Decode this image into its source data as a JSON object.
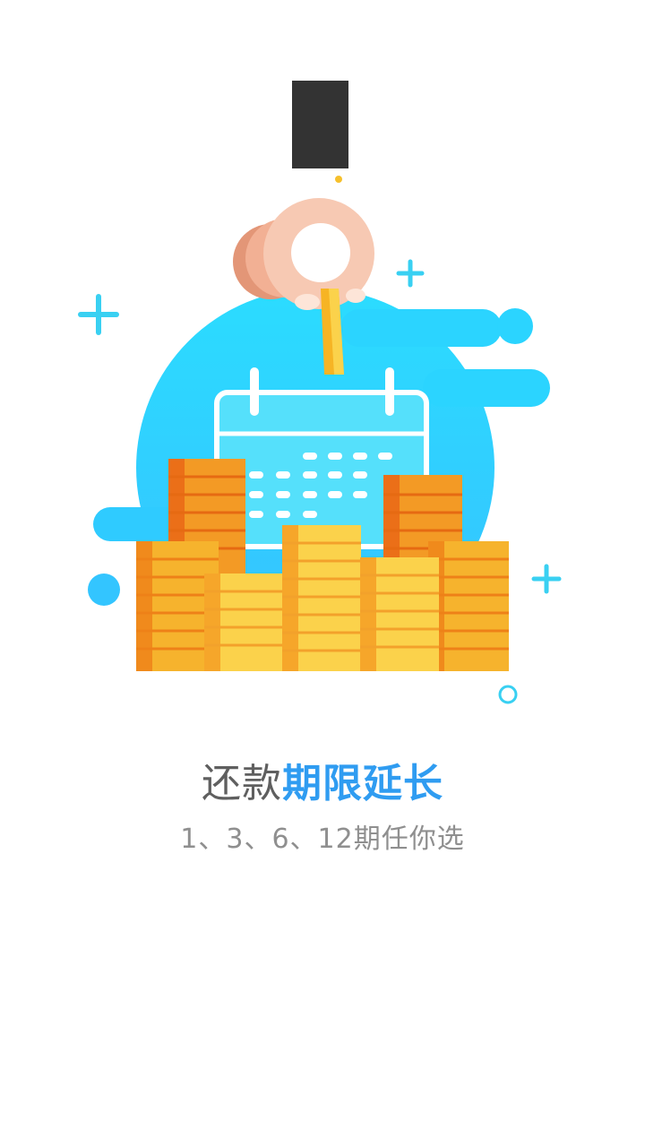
{
  "headline": {
    "normal": "还款",
    "highlight": "期限延长"
  },
  "subtitle": "1、3、6、12期任你选",
  "colors": {
    "accent": "#2f9cf1",
    "title_gray": "#5f5f5f",
    "subtitle_gray": "#8f8f8f",
    "blob_blue": "#2ad0ff",
    "coin_orange": "#f39a25",
    "coin_yellow": "#fbd24b"
  },
  "illustration": {
    "description_icon": "hand-inserting-coin-into-calendar-with-coin-stacks"
  }
}
